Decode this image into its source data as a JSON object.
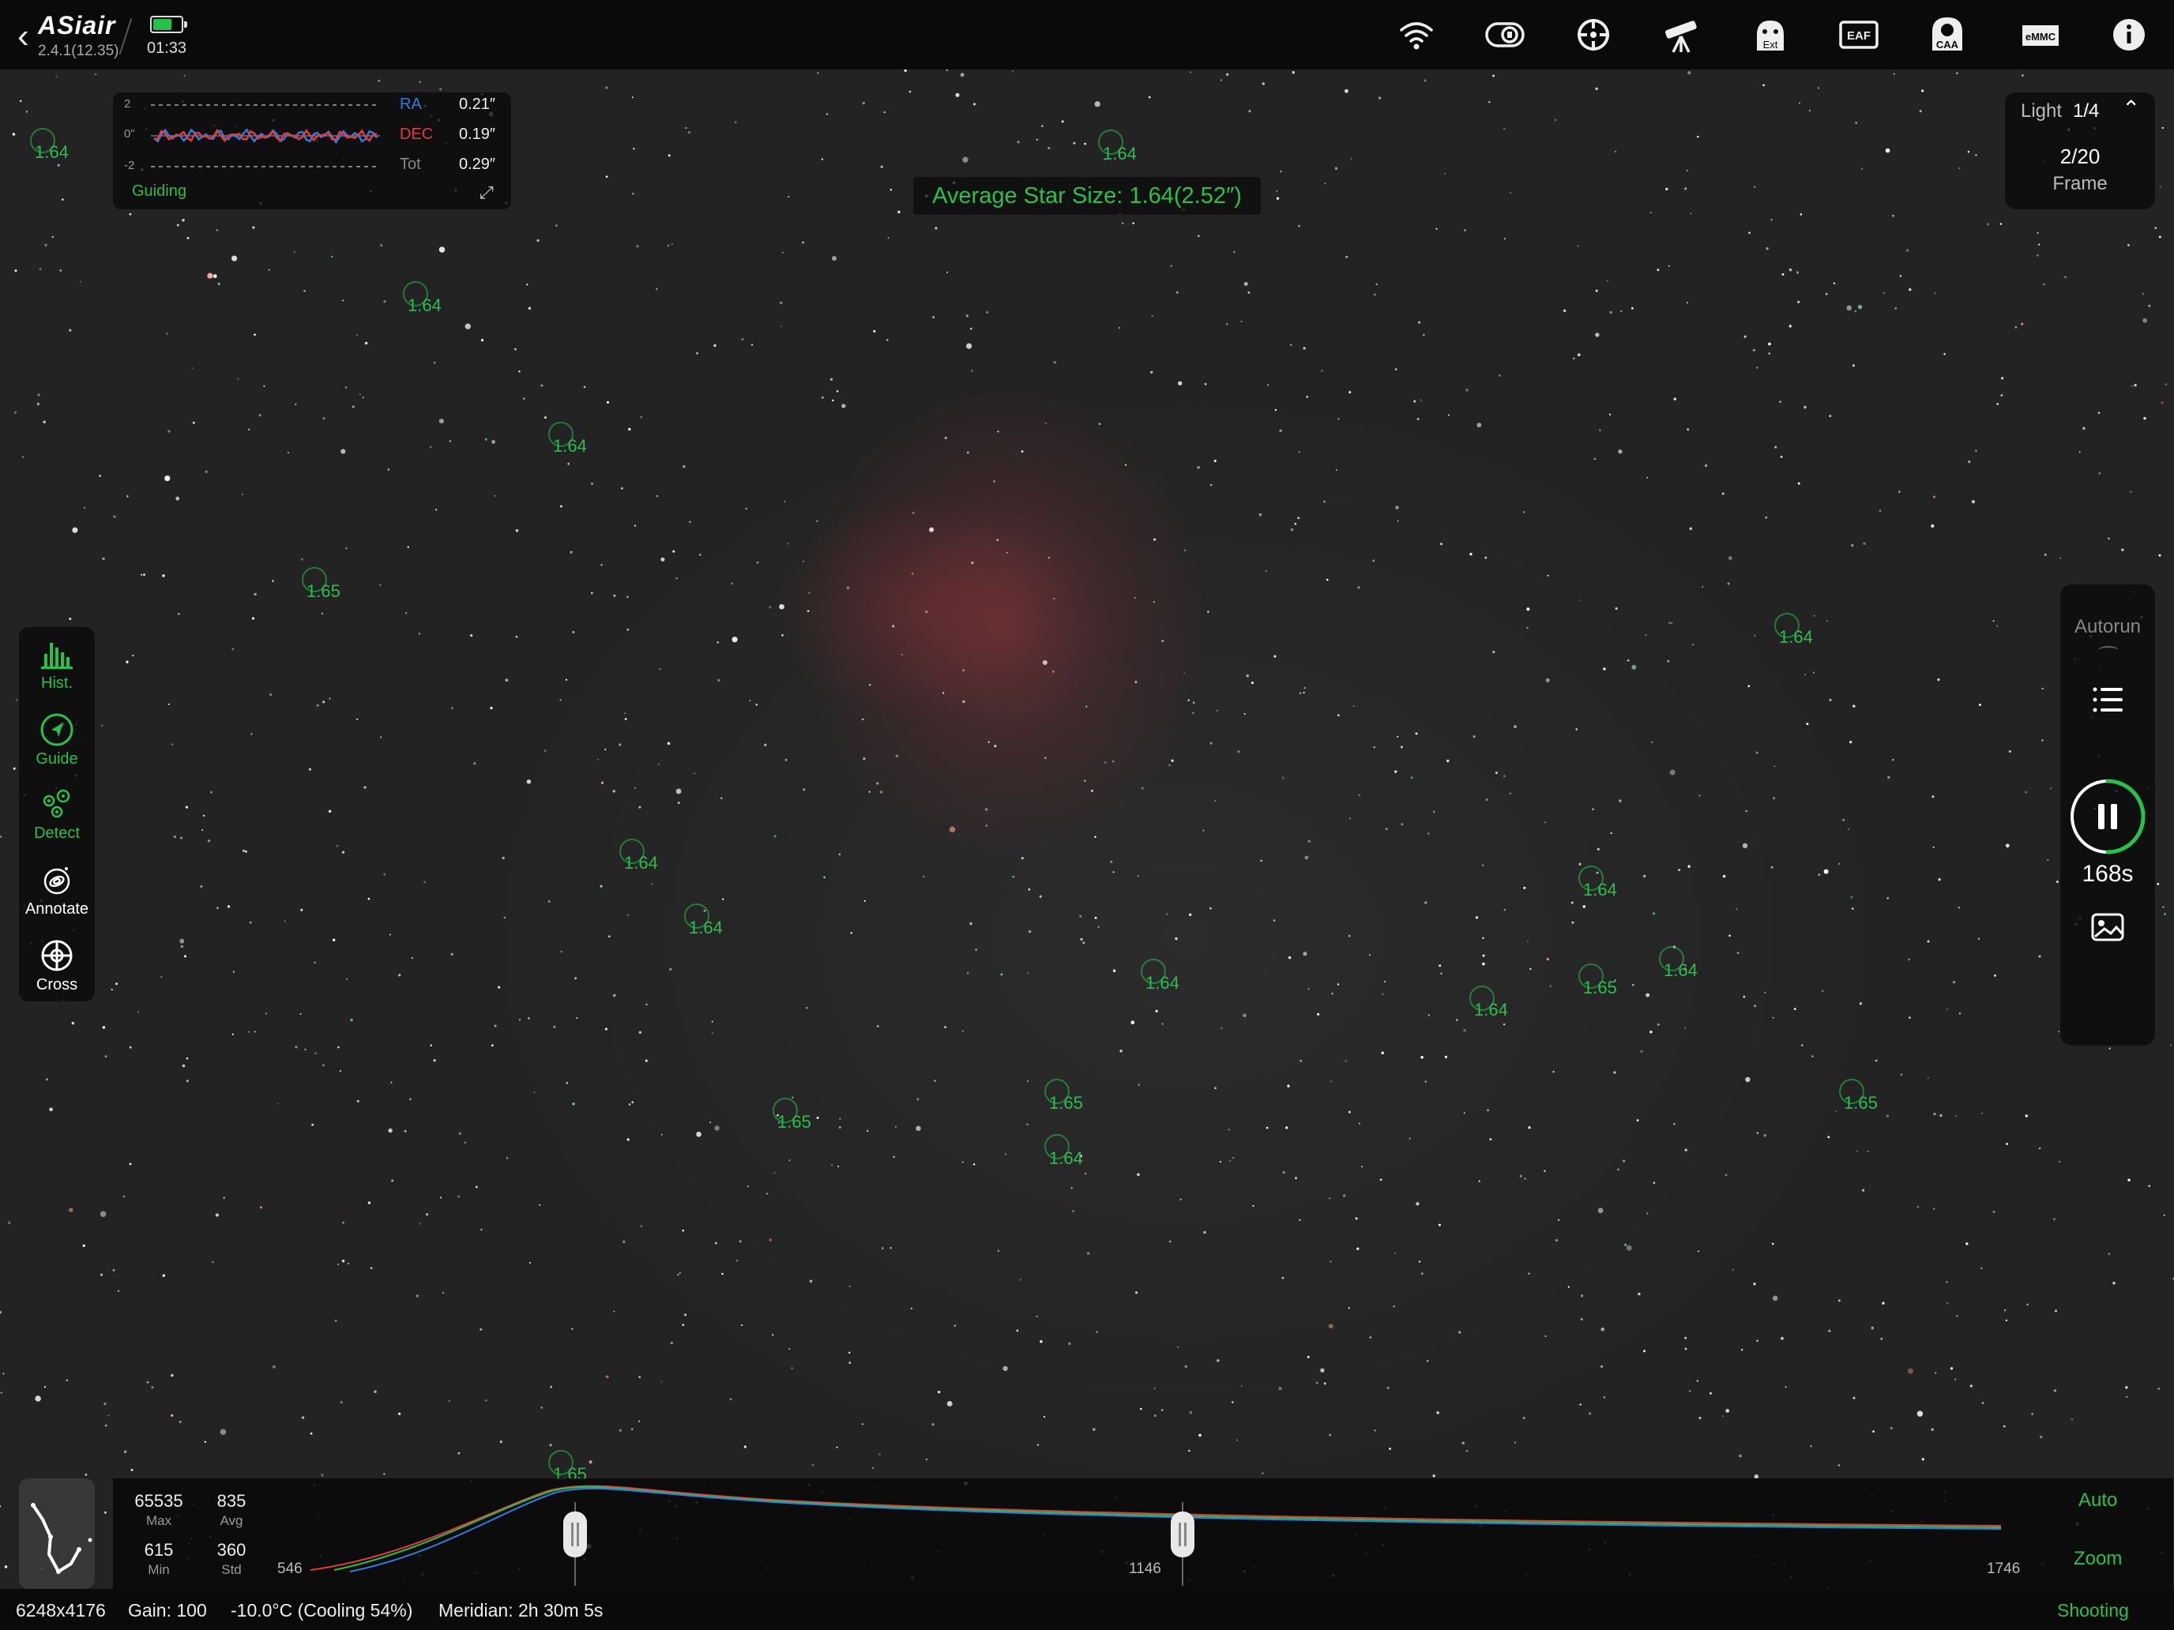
{
  "app": {
    "logo": "ASiair",
    "version": "2.4.1(12.35)",
    "clock": "01:33",
    "battery_level": 0.75
  },
  "topbar": {
    "icons": [
      {
        "name": "wifi-icon",
        "label": ""
      },
      {
        "name": "camera-icon",
        "label": ""
      },
      {
        "name": "guide-scope-icon",
        "label": ""
      },
      {
        "name": "telescope-icon",
        "label": ""
      },
      {
        "name": "ext-icon",
        "label": "Ext"
      },
      {
        "name": "eaf-icon",
        "label": "EAF"
      },
      {
        "name": "caa-icon",
        "label": "CAA"
      },
      {
        "name": "emmc-icon",
        "label": "eMMC"
      },
      {
        "name": "info-icon",
        "label": ""
      }
    ]
  },
  "guiding": {
    "ticks": {
      "top": "2",
      "mid": "0\"",
      "bottom": "-2"
    },
    "rows": [
      {
        "label": "RA",
        "value": "0.21″",
        "color": "#2f7de1"
      },
      {
        "label": "DEC",
        "value": "0.19″",
        "color": "#e23b3b"
      },
      {
        "label": "Tot",
        "value": "0.29″",
        "color": "#888888"
      }
    ],
    "title": "Guiding"
  },
  "avg_star_size": "Average Star Size: 1.64(2.52″)",
  "stars": [
    {
      "label": "1.64"
    },
    {
      "label": "1.64"
    },
    {
      "label": "1.64"
    },
    {
      "label": "1.64"
    },
    {
      "label": "1.65"
    },
    {
      "label": "1.64"
    },
    {
      "label": "1.64"
    },
    {
      "label": "1.64"
    },
    {
      "label": "1.64"
    },
    {
      "label": "1.65"
    },
    {
      "label": "1.64"
    },
    {
      "label": "1.64"
    },
    {
      "label": "1.64"
    },
    {
      "label": "1.65"
    },
    {
      "label": "1.65"
    },
    {
      "label": "1.64"
    },
    {
      "label": "1.65"
    },
    {
      "label": "1.65"
    }
  ],
  "frame": {
    "mode": "Light",
    "count": "1/4",
    "progress": "2/20",
    "unit": "Frame"
  },
  "left_tools": [
    {
      "name": "hist",
      "label": "Hist.",
      "active": true
    },
    {
      "name": "guide",
      "label": "Guide",
      "active": true
    },
    {
      "name": "detect",
      "label": "Detect",
      "active": true
    },
    {
      "name": "annotate",
      "label": "Annotate",
      "active": false
    },
    {
      "name": "cross",
      "label": "Cross",
      "active": false
    }
  ],
  "right_tools": {
    "autorun": "Autorun",
    "timer": "168s"
  },
  "histogram": {
    "stats": [
      {
        "value": "65535",
        "key": "Max"
      },
      {
        "value": "835",
        "key": "Avg"
      },
      {
        "value": "615",
        "key": "Min"
      },
      {
        "value": "360",
        "key": "Std"
      }
    ],
    "axis": [
      "546",
      "1146",
      "1746"
    ],
    "auto": "Auto",
    "zoom": "Zoom"
  },
  "status": {
    "resolution": "6248x4176",
    "gain": "Gain: 100",
    "temperature": "-10.0°C (Cooling 54%)",
    "meridian": "Meridian: 2h 30m 5s",
    "state": "Shooting"
  },
  "colors": {
    "accent_green": "#27c24c",
    "ra_blue": "#2f7de1",
    "dec_red": "#e23b3b",
    "nebula": "#96373c"
  }
}
